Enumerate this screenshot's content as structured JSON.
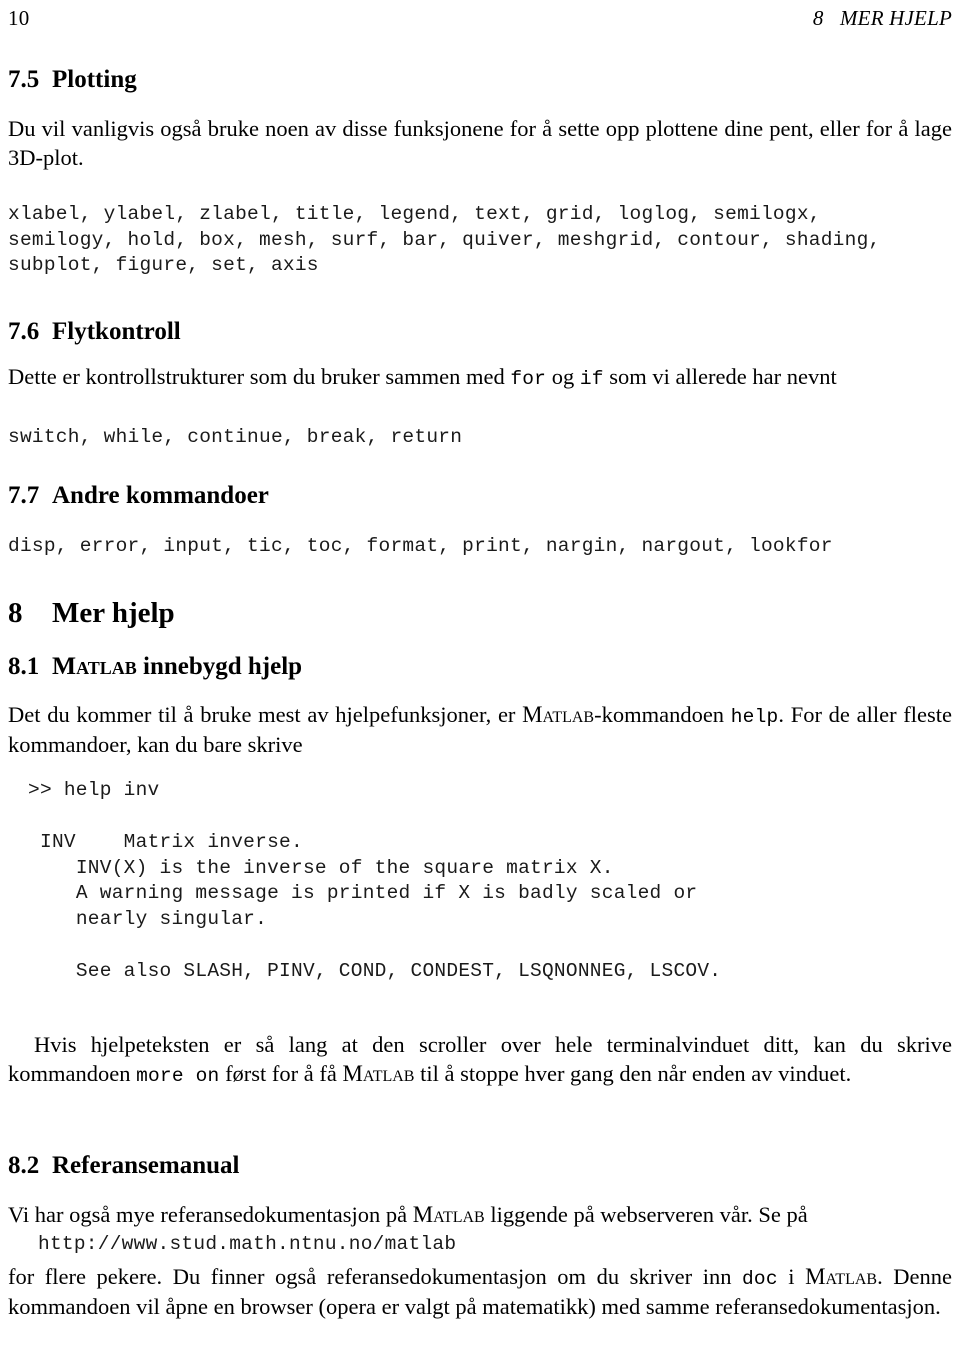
{
  "header": {
    "folio": "10",
    "section_number": "8",
    "section_title": "MER HJELP"
  },
  "sections": [
    {
      "id": "7.5",
      "number": "7.5",
      "title": "Plotting",
      "paragraph": "Du vil vanligvis også bruke noen av disse funksjonene for å sette opp plottene dine pent, eller for å lage 3D-plot.",
      "code_lines": [
        "xlabel, ylabel, zlabel, title, legend, text, grid, loglog, semilogx,",
        "semilogy, hold, box, mesh, surf, bar, quiver, meshgrid, contour, shading,",
        "subplot, figure, set, axis"
      ]
    },
    {
      "id": "7.6",
      "number": "7.6",
      "title": "Flytkontroll",
      "para_part1": "Dette er kontrollstrukturer som du bruker sammen med ",
      "para_mono1": "for",
      "para_part2": " og ",
      "para_mono2": "if",
      "para_part3": " som vi allerede har nevnt",
      "code_lines": [
        "switch, while, continue, break, return"
      ]
    },
    {
      "id": "7.7",
      "number": "7.7",
      "title": "Andre kommandoer",
      "code_lines": [
        "disp, error, input, tic, toc, format, print, nargin, nargout, lookfor"
      ]
    }
  ],
  "chapter": {
    "number": "8",
    "title": "Mer hjelp"
  },
  "subsection_8_1": {
    "number": "8.1",
    "title_sc": "Matlab",
    "title_rest": " innebygd hjelp",
    "para_part1": "Det du kommer til å bruke mest av hjelpefunksjoner, er ",
    "para_sc": "Matlab",
    "para_part2": "-kommandoen ",
    "para_mono": "help",
    "para_part3": ". For de aller fleste kommandoer, kan du bare skrive",
    "prompt_line": ">> help inv",
    "help_lines": [
      "INV    Matrix inverse.",
      "   INV(X) is the inverse of the square matrix X.",
      "   A warning message is printed if X is badly scaled or",
      "   nearly singular.",
      "",
      "   See also SLASH, PINV, COND, CONDEST, LSQNONNEG, LSCOV."
    ],
    "para2_part1": "Hvis hjelpeteksten er så lang at den scroller over hele terminalvinduet ditt, kan du skrive kommandoen ",
    "para2_mono": "more on",
    "para2_part2": " først for å få ",
    "para2_sc": "Matlab",
    "para2_part3": " til å stoppe hver gang den når enden av vinduet."
  },
  "subsection_8_2": {
    "number": "8.2",
    "title": "Referansemanual",
    "para_part1": "Vi har også mye referansedokumentasjon på ",
    "para_sc1": "Matlab",
    "para_part2": " liggende på webserveren vår. Se på",
    "url": "http://www.stud.math.ntnu.no/matlab",
    "para2_part1": "for flere pekere. Du finner også referansedokumentasjon om du skriver inn ",
    "para2_mono": "doc",
    "para2_part2": " i ",
    "para2_sc": "Matlab",
    "para2_part3": ". Denne kommandoen vil åpne en browser (opera er valgt på matematikk) med samme referansedokumentasjon."
  }
}
